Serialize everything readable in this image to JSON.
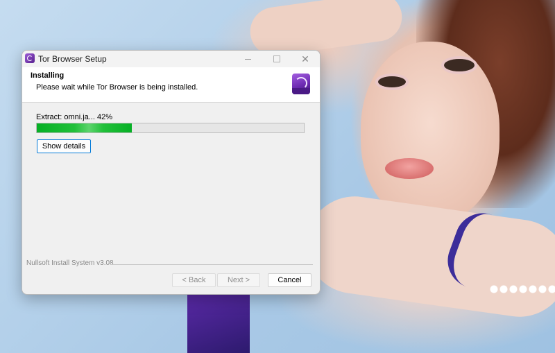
{
  "window": {
    "title": "Tor Browser Setup",
    "icon": "tor-browser-icon"
  },
  "header": {
    "title": "Installing",
    "subtitle": "Please wait while Tor Browser is being installed.",
    "logo": "tor-browser-logo"
  },
  "progress": {
    "status_text": "Extract: omni.ja... 42%",
    "percent": 42,
    "bar_color": "#06b025"
  },
  "buttons": {
    "show_details": "Show details",
    "back": "< Back",
    "next": "Next >",
    "cancel": "Cancel"
  },
  "footer": {
    "brand": "Nullsoft Install System v3.08"
  },
  "colors": {
    "accent_border": "#0078d7",
    "progress_green": "#06b025"
  }
}
